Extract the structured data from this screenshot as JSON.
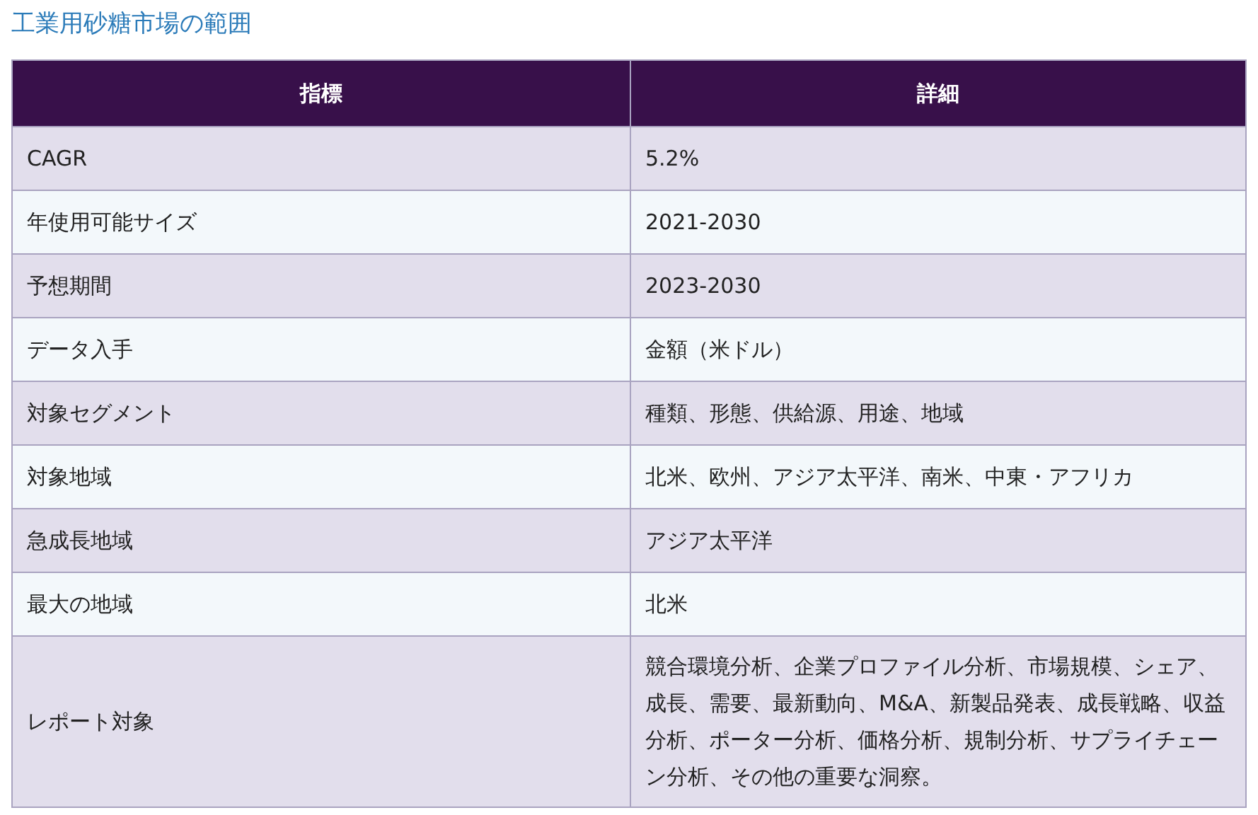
{
  "title": "工業用砂糖市場の範囲",
  "table": {
    "columns": [
      "指標",
      "詳細"
    ],
    "rows": [
      {
        "metric": "CAGR",
        "detail": "5.2%"
      },
      {
        "metric": "年使用可能サイズ",
        "detail": "2021-2030"
      },
      {
        "metric": "予想期間",
        "detail": "2023-2030"
      },
      {
        "metric": "データ入手",
        "detail": "金額（米ドル）"
      },
      {
        "metric": "対象セグメント",
        "detail": "種類、形態、供給源、用途、地域"
      },
      {
        "metric": "対象地域",
        "detail": "北米、欧州、アジア太平洋、南米、中東・アフリカ"
      },
      {
        "metric": "急成長地域",
        "detail": "アジア太平洋"
      },
      {
        "metric": "最大の地域",
        "detail": "北米"
      },
      {
        "metric": "レポート対象",
        "detail": "競合環境分析、企業プロファイル分析、市場規模、シェア、成長、需要、最新動向、M&A、新製品発表、成長戦略、収益分析、ポーター分析、価格分析、規制分析、サプライチェーン分析、その他の重要な洞察。"
      }
    ]
  }
}
